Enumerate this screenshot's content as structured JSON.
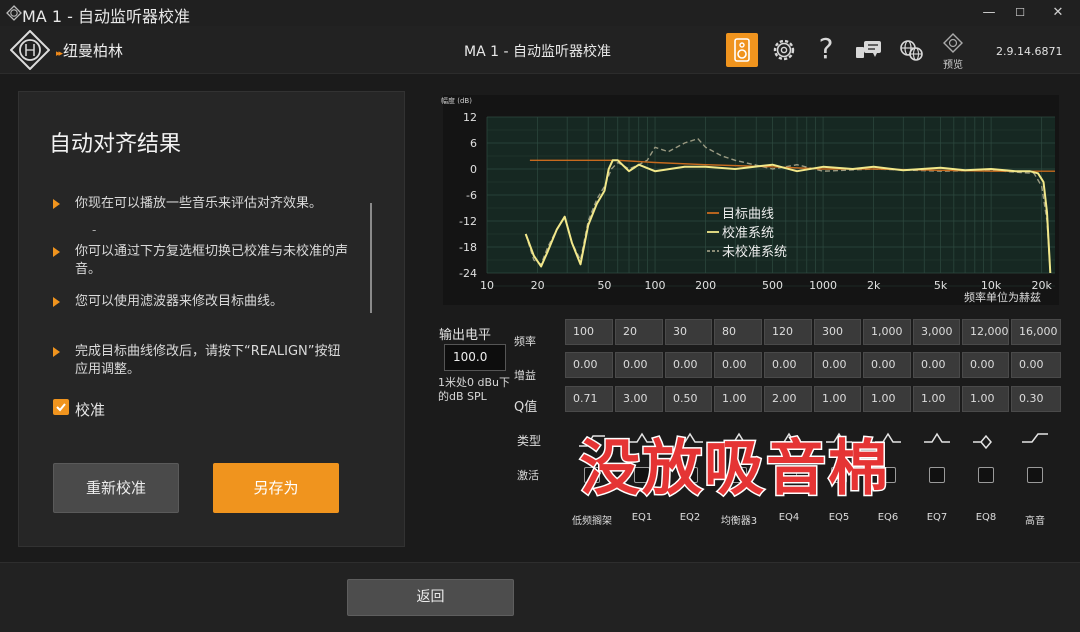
{
  "window": {
    "title": "MA 1 - 自动监听器校准",
    "controls": [
      "—",
      "☐",
      "✕"
    ]
  },
  "header": {
    "brand": "纽曼柏林",
    "brand_arrows": "▸▸",
    "title": "MA 1 - 自动监听器校准",
    "help": "?",
    "preview_label": "预览",
    "version": "2.9.14.6871",
    "accent_color": "#f0941e",
    "icons": [
      "speaker-icon",
      "gear-icon",
      "help-icon",
      "chat-icon",
      "language-icon",
      "preview-icon"
    ]
  },
  "panel": {
    "title": "自动对齐结果",
    "bullets": [
      "你现在可以播放一些音乐来评估对齐效果。",
      "你可以通过下方复选框切换已校准与未校准的声音。",
      "您可以使用滤波器来修改目标曲线。",
      "完成目标曲线修改后，请按下“REALIGN”按钮应用调整。"
    ],
    "dash": "-",
    "calibrated_label": "校准",
    "calibrated_checked": true,
    "recalibrate_label": "重新校准",
    "save_as_label": "另存为"
  },
  "chart_data": {
    "type": "line",
    "ylabel": "幅度 (dB)",
    "xlabel": "频率单位为赫兹",
    "x_scale": "log",
    "xlim": [
      10,
      24000
    ],
    "ylim": [
      -24,
      12
    ],
    "grid": true,
    "legend_placement": "center-left",
    "x_ticks": [
      10,
      20,
      50,
      100,
      200,
      500,
      1000,
      2000,
      5000,
      10000,
      20000
    ],
    "x_tick_labels": [
      "10",
      "20",
      "50",
      "100",
      "200",
      "500",
      "1000",
      "2k",
      "5k",
      "10k",
      "20k"
    ],
    "y_ticks": [
      12,
      6,
      0,
      -6,
      -12,
      -18,
      -24
    ],
    "y_tick_labels": [
      "12",
      "6",
      "0",
      "-6",
      "-12",
      "-18",
      "-24"
    ],
    "series": [
      {
        "name": "目标曲线",
        "color": "#c76a1e",
        "style": "solid",
        "x": [
          18,
          40,
          60,
          100,
          200,
          500,
          1000,
          2000,
          5000,
          10000,
          20000,
          24000
        ],
        "y": [
          2,
          2,
          2,
          1.5,
          1,
          0.5,
          0,
          0,
          -0.3,
          -0.5,
          -0.5,
          -0.5
        ]
      },
      {
        "name": "校准系统",
        "color": "#f2e88a",
        "style": "solid",
        "x": [
          17,
          19,
          21,
          23,
          26,
          29,
          32,
          36,
          40,
          45,
          50,
          53,
          56,
          60,
          70,
          80,
          100,
          150,
          200,
          300,
          500,
          700,
          1000,
          1500,
          2000,
          3000,
          5000,
          7000,
          10000,
          14000,
          17000,
          19000,
          20500,
          21500,
          22500
        ],
        "y": [
          -15,
          -20,
          -22.5,
          -19,
          -14,
          -11,
          -17,
          -22,
          -13,
          -8,
          -5,
          0,
          2,
          2,
          -0.5,
          1,
          -0.5,
          0.5,
          0.5,
          0,
          1,
          -0.5,
          0.5,
          0,
          0.5,
          -0.3,
          0.3,
          -0.3,
          0,
          -0.5,
          -0.5,
          -1,
          -3,
          -10,
          -24
        ]
      },
      {
        "name": "未校准系统",
        "color": "#9a9a82",
        "style": "dashed",
        "x": [
          17,
          19,
          21,
          23,
          26,
          29,
          32,
          36,
          40,
          45,
          50,
          55,
          60,
          70,
          80,
          90,
          100,
          120,
          150,
          180,
          200,
          250,
          300,
          500,
          700,
          1000,
          2000,
          5000,
          10000,
          15000,
          18000,
          20000,
          21500,
          22500
        ],
        "y": [
          -15,
          -21,
          -22,
          -18,
          -14,
          -11,
          -17,
          -21,
          -12,
          -7,
          -4,
          0,
          1.5,
          0,
          1,
          2,
          5,
          4,
          6,
          7,
          5,
          3,
          2,
          0,
          1,
          -0.5,
          0,
          -0.5,
          -0.3,
          -0.8,
          -1,
          -4,
          -12,
          -24
        ]
      }
    ]
  },
  "eq": {
    "output_label": "输出电平",
    "output_value": "100.0",
    "output_unit": "1米处0 dBu下的dB SPL",
    "row_labels": {
      "freq": "频率",
      "gain": "增益",
      "q": "Q值",
      "type": "类型",
      "active": "激活"
    },
    "freq": [
      "100",
      "20",
      "30",
      "80",
      "120",
      "300",
      "1,000",
      "3,000",
      "12,000",
      "16,000"
    ],
    "gain": [
      "0.00",
      "0.00",
      "0.00",
      "0.00",
      "0.00",
      "0.00",
      "0.00",
      "0.00",
      "0.00",
      "0.00"
    ],
    "q": [
      "0.71",
      "3.00",
      "0.50",
      "1.00",
      "2.00",
      "1.00",
      "1.00",
      "1.00",
      "1.00",
      "0.30"
    ],
    "bands": [
      "低频搁架",
      "EQ1",
      "EQ2",
      "均衡器3",
      "EQ4",
      "EQ5",
      "EQ6",
      "EQ7",
      "EQ8",
      "高音"
    ]
  },
  "overlay_text": "没放吸音棉",
  "footer": {
    "back_label": "返回"
  }
}
